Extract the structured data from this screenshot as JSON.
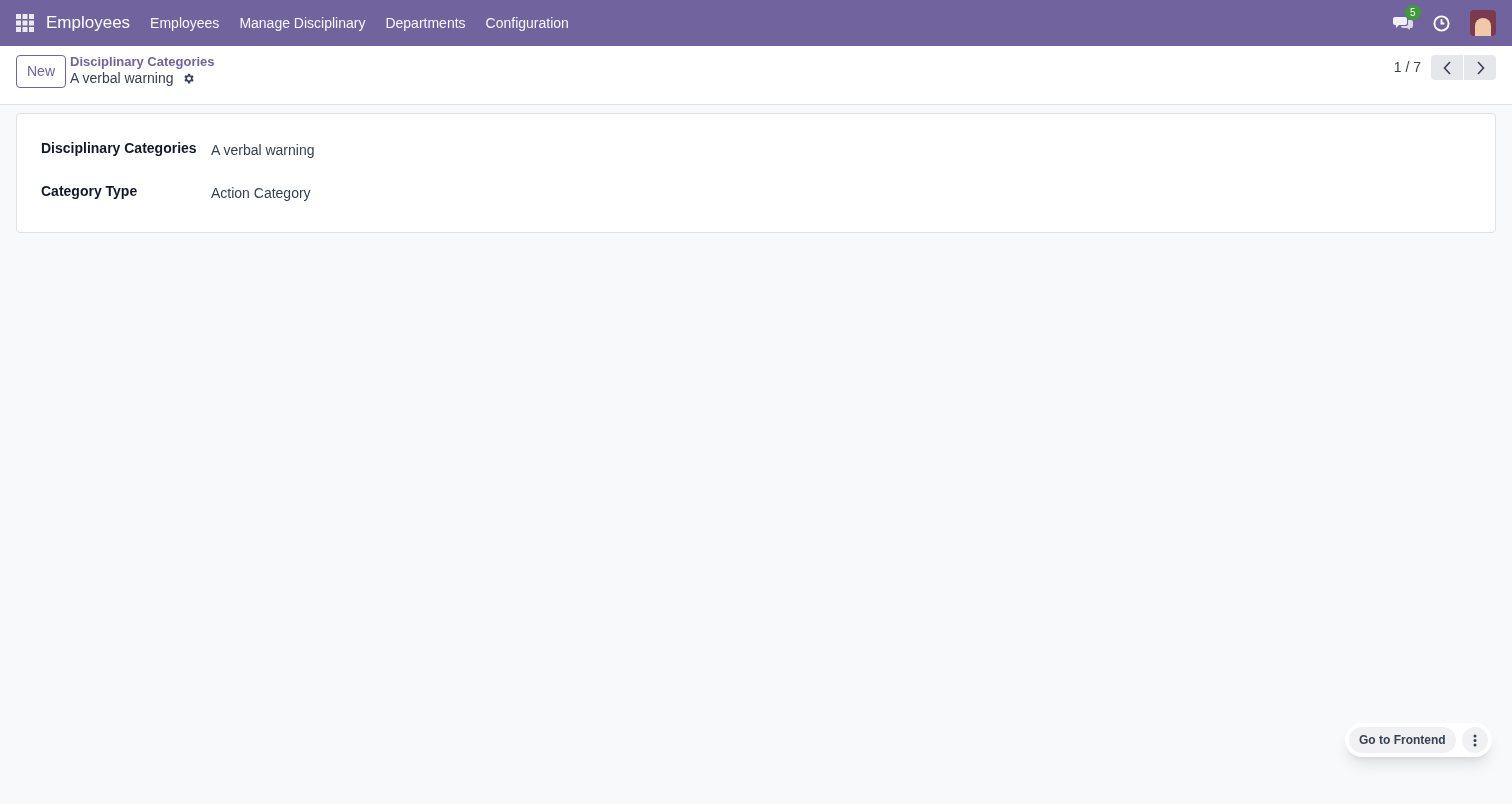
{
  "navbar": {
    "app_name": "Employees",
    "menu": [
      "Employees",
      "Manage Disciplinary",
      "Departments",
      "Configuration"
    ],
    "messages_badge": "5"
  },
  "control_panel": {
    "new_button": "New",
    "breadcrumb": "Disciplinary Categories",
    "record_title": "A verbal warning",
    "pager": "1 / 7"
  },
  "form": {
    "fields": [
      {
        "label": "Disciplinary Categories",
        "value": "A verbal warning"
      },
      {
        "label": "Category Type",
        "value": "Action Category"
      }
    ]
  },
  "floating": {
    "button": "Go to Frontend"
  }
}
